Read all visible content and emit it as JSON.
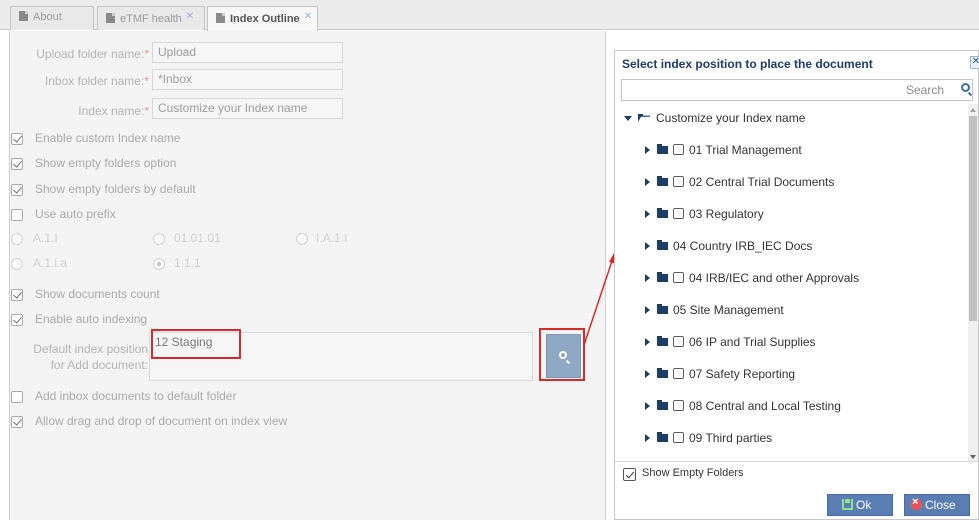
{
  "tabs": [
    {
      "label": "About",
      "active": false,
      "closable": false
    },
    {
      "label": "eTMF health",
      "active": false,
      "closable": true
    },
    {
      "label": "Index Outline",
      "active": true,
      "closable": true
    }
  ],
  "form": {
    "upload_label": "Upload folder name:",
    "upload_value": "Upload",
    "inbox_label": "Inbox folder name:",
    "inbox_value": "*Inbox",
    "index_label": "Index name:",
    "index_value": "Customize your Index name",
    "required_mark": "*",
    "checkbox_enable_custom": "Enable custom Index name",
    "checkbox_show_empty_option": "Show empty folders option",
    "checkbox_show_empty_default": "Show empty folders by default",
    "checkbox_auto_prefix": "Use auto prefix",
    "radio_a11": "A.1.I",
    "radio_010101": "01.01.01",
    "radio_ia1i": "I.A.1.I",
    "radio_a1ia": "A.1.i.a",
    "radio_111": "1.1.1",
    "checkbox_docs_count": "Show documents count",
    "checkbox_auto_indexing": "Enable auto indexing",
    "default_pos_label_1": "Default index position",
    "default_pos_label_2": "for Add document:",
    "default_pos_value": "12 Staging",
    "checkbox_add_inbox": "Add inbox documents to default folder",
    "checkbox_drag_drop": "Allow drag and drop of document on index view"
  },
  "dialog": {
    "title": "Select index position to place the document",
    "close_glyph": "✕",
    "search_placeholder": "Search",
    "root_label": "Customize your Index name",
    "items": [
      {
        "label": "01 Trial Management",
        "checkbox": true
      },
      {
        "label": "02 Central Trial Documents",
        "checkbox": true
      },
      {
        "label": "03 Regulatory",
        "checkbox": true
      },
      {
        "label": "04 Country IRB_IEC Docs",
        "checkbox": false
      },
      {
        "label": "04 IRB/IEC and other Approvals",
        "checkbox": true
      },
      {
        "label": "05 Site Management",
        "checkbox": false
      },
      {
        "label": "06 IP and Trial Supplies",
        "checkbox": true
      },
      {
        "label": "07 Safety Reporting",
        "checkbox": true
      },
      {
        "label": "08 Central and Local Testing",
        "checkbox": true
      },
      {
        "label": "09 Third parties",
        "checkbox": true
      }
    ],
    "show_empty_label": "Show Empty Folders",
    "ok_label": "Ok",
    "close_label": "Close"
  },
  "colors": {
    "highlight_red": "#d92a2a",
    "button_blue": "#5a7eb3",
    "title_navy": "#1f3d66"
  }
}
